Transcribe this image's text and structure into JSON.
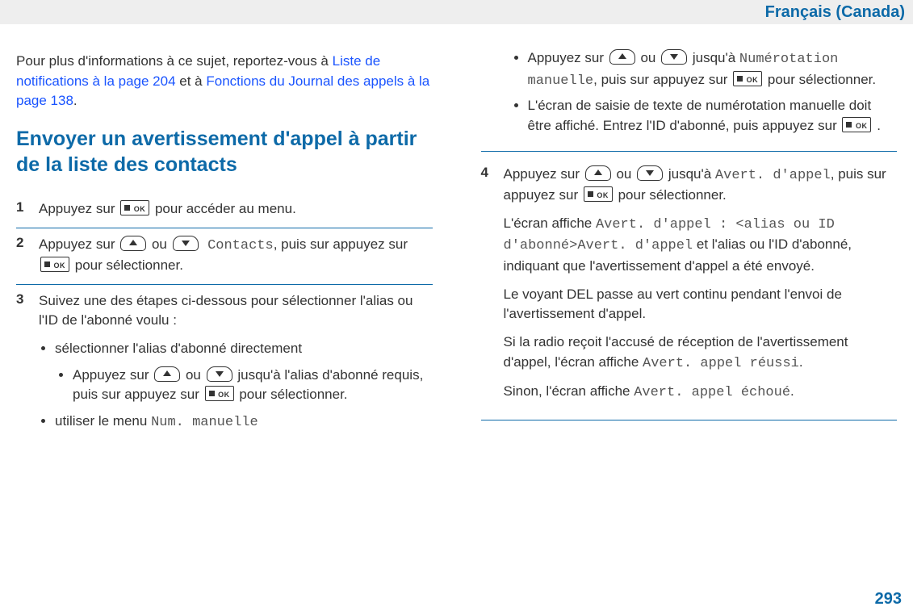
{
  "header": {
    "locale": "Français (Canada)"
  },
  "intro": {
    "pre": "Pour plus d'informations à ce sujet, reportez-vous à ",
    "link1": "Liste de notifications à la page 204",
    "mid": " et à ",
    "link2": "Fonctions du Journal des appels à la page 138",
    "end": "."
  },
  "title": "Envoyer un avertissement d'appel à partir de la liste des contacts",
  "left": {
    "step1": {
      "a": "Appuyez sur ",
      "b": " pour accéder au menu."
    },
    "step2": {
      "a": "Appuyez sur ",
      "ou": " ou ",
      "contacts": "Contacts",
      "mid": ", puis sur appuyez sur ",
      "end": " pour sélectionner."
    },
    "step3": {
      "lead": "Suivez une des étapes ci-dessous pour sélectionner l'alias ou l'ID de l'abonné voulu :",
      "opt1": "sélectionner l'alias d'abonné directement",
      "opt1sub": {
        "a": "Appuyez sur ",
        "ou": " ou ",
        "b": " jusqu'à l'alias d'abonné requis, puis sur appuyez sur ",
        "c": " pour sélectionner."
      },
      "opt2a": "utiliser le menu ",
      "opt2mono": "Num. manuelle"
    }
  },
  "right": {
    "cont": {
      "b1": {
        "a": "Appuyez sur ",
        "ou": " ou ",
        "j": " jusqu'à ",
        "mono": "Numérotation manuelle",
        "mid": ", puis sur appuyez sur ",
        "end": " pour sélectionner."
      },
      "b2": {
        "a": "L'écran de saisie de texte de numérotation manuelle doit être affiché. Entrez l'ID d'abonné, puis appuyez sur ",
        "end": " ."
      }
    },
    "step4": {
      "a": "Appuyez sur ",
      "ou": " ou ",
      "j": " jusqu'à ",
      "mono1": "Avert. d'appel",
      "mid": ", puis sur appuyez sur ",
      "sel": " pour sélectionner.",
      "p2a": "L'écran affiche ",
      "p2mono": "Avert. d'appel : <alias ou ID d'abonné>Avert. d'appel",
      "p2b": " et l'alias ou l'ID d'abonné, indiquant que l'avertissement d'appel a été envoyé.",
      "p3": "Le voyant DEL passe au vert continu pendant l'envoi de l'avertissement d'appel.",
      "p4a": "Si la radio reçoit l'accusé de réception de l'avertissement d'appel, l'écran affiche ",
      "p4mono": "Avert. appel réussi",
      "p4b": ".",
      "p5a": "Sinon, l'écran affiche ",
      "p5mono": "Avert. appel échoué",
      "p5b": "."
    }
  },
  "pageNumber": "293"
}
